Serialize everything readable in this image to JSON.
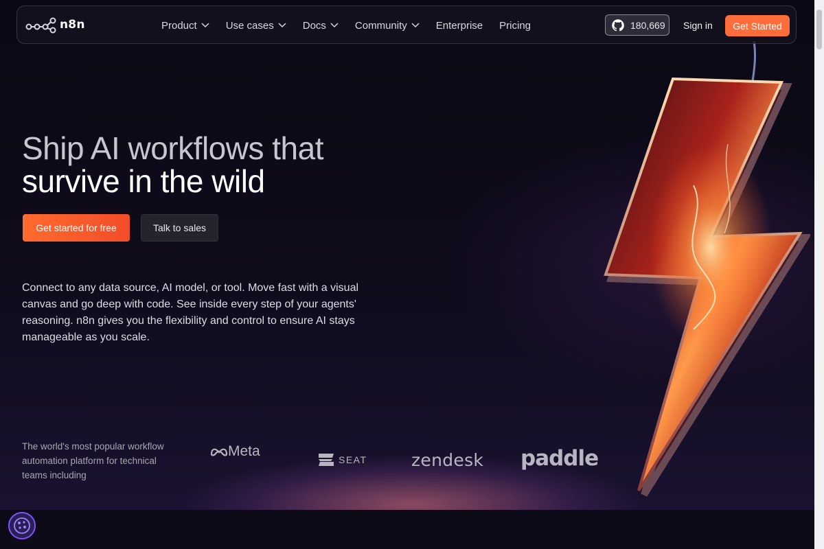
{
  "brand": {
    "name": "n8n"
  },
  "nav": {
    "items": [
      {
        "label": "Product",
        "dropdown": true
      },
      {
        "label": "Use cases",
        "dropdown": true
      },
      {
        "label": "Docs",
        "dropdown": true
      },
      {
        "label": "Community",
        "dropdown": true
      },
      {
        "label": "Enterprise",
        "dropdown": false
      },
      {
        "label": "Pricing",
        "dropdown": false
      }
    ],
    "github_stars": "180,669",
    "signin_label": "Sign in",
    "cta_label": "Get Started"
  },
  "hero": {
    "headline_line1": "Ship AI workflows that",
    "headline_line2": "survive in the wild",
    "primary_cta": "Get started for free",
    "secondary_cta": "Talk to sales",
    "description": "Connect to any data source, AI model, or tool. Move fast with a visual canvas and go deep with code. See inside every step of your agents' reasoning. n8n gives you the flexibility and control to ensure AI stays manageable as you scale."
  },
  "trust": {
    "text": "The world's most popular workflow automation platform for technical teams including",
    "logos": [
      "Meta",
      "SEAT",
      "zendesk",
      "paddle"
    ]
  },
  "colors": {
    "accent": "#ff6d3a",
    "background": "#0e0b18",
    "cookie_accent": "#7b56ff"
  },
  "icons": [
    "n8n-logo-icon",
    "chevron-down-icon",
    "github-icon",
    "meta-logo-icon",
    "seat-logo-icon",
    "lightning-bolt-icon",
    "cookie-settings-icon"
  ]
}
